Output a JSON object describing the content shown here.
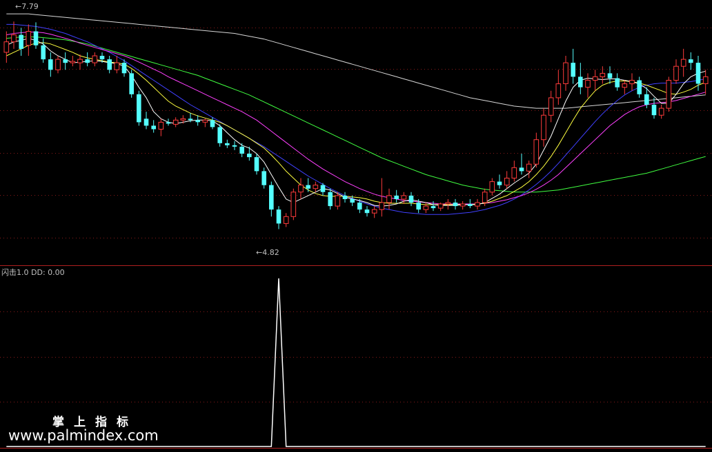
{
  "chart_data": [
    {
      "type": "candlestick",
      "title": "",
      "price_range": [
        4.5,
        8.0
      ],
      "annotations": {
        "high_label": "7.79",
        "low_label": "4.82"
      },
      "colors": {
        "up": "#ff3b3b",
        "down": "#54ffff",
        "ma5": "#ffffff",
        "ma10": "#ffff40",
        "ma20": "#ff40ff",
        "ma30": "#4040ff",
        "ma60": "#40ff40",
        "ma120": "#d8d8d8"
      },
      "ohlc": [
        [
          7.35,
          7.65,
          7.2,
          7.5
        ],
        [
          7.5,
          7.79,
          7.4,
          7.6
        ],
        [
          7.6,
          7.7,
          7.3,
          7.4
        ],
        [
          7.45,
          7.75,
          7.3,
          7.65
        ],
        [
          7.65,
          7.78,
          7.4,
          7.45
        ],
        [
          7.45,
          7.55,
          7.2,
          7.25
        ],
        [
          7.25,
          7.35,
          7.0,
          7.1
        ],
        [
          7.1,
          7.3,
          7.05,
          7.25
        ],
        [
          7.25,
          7.35,
          7.1,
          7.2
        ],
        [
          7.2,
          7.3,
          7.15,
          7.22
        ],
        [
          7.2,
          7.32,
          7.1,
          7.25
        ],
        [
          7.25,
          7.35,
          7.15,
          7.2
        ],
        [
          7.2,
          7.35,
          7.15,
          7.3
        ],
        [
          7.3,
          7.35,
          7.2,
          7.25
        ],
        [
          7.25,
          7.3,
          7.05,
          7.1
        ],
        [
          7.1,
          7.3,
          7.05,
          7.2
        ],
        [
          7.2,
          7.25,
          7.0,
          7.05
        ],
        [
          7.05,
          7.1,
          6.7,
          6.75
        ],
        [
          6.75,
          6.8,
          6.3,
          6.35
        ],
        [
          6.4,
          6.5,
          6.25,
          6.3
        ],
        [
          6.3,
          6.38,
          6.2,
          6.25
        ],
        [
          6.25,
          6.4,
          6.15,
          6.35
        ],
        [
          6.35,
          6.4,
          6.3,
          6.33
        ],
        [
          6.32,
          6.42,
          6.28,
          6.38
        ],
        [
          6.38,
          6.45,
          6.33,
          6.4
        ],
        [
          6.4,
          6.48,
          6.35,
          6.38
        ],
        [
          6.38,
          6.45,
          6.3,
          6.35
        ],
        [
          6.35,
          6.4,
          6.28,
          6.38
        ],
        [
          6.38,
          6.42,
          6.25,
          6.28
        ],
        [
          6.28,
          6.32,
          6.0,
          6.05
        ],
        [
          6.05,
          6.1,
          5.98,
          6.02
        ],
        [
          6.02,
          6.08,
          5.95,
          6.0
        ],
        [
          6.0,
          6.05,
          5.85,
          5.9
        ],
        [
          5.9,
          6.0,
          5.8,
          5.85
        ],
        [
          5.85,
          5.9,
          5.6,
          5.65
        ],
        [
          5.65,
          5.7,
          5.4,
          5.45
        ],
        [
          5.45,
          5.5,
          5.0,
          5.1
        ],
        [
          5.1,
          5.15,
          4.82,
          4.9
        ],
        [
          4.9,
          5.05,
          4.85,
          5.0
        ],
        [
          5.0,
          5.4,
          4.95,
          5.35
        ],
        [
          5.35,
          5.55,
          5.25,
          5.45
        ],
        [
          5.45,
          5.55,
          5.35,
          5.4
        ],
        [
          5.4,
          5.5,
          5.35,
          5.45
        ],
        [
          5.45,
          5.48,
          5.3,
          5.35
        ],
        [
          5.35,
          5.4,
          5.1,
          5.15
        ],
        [
          5.15,
          5.35,
          5.1,
          5.3
        ],
        [
          5.3,
          5.35,
          5.2,
          5.25
        ],
        [
          5.25,
          5.3,
          5.15,
          5.2
        ],
        [
          5.2,
          5.25,
          5.05,
          5.1
        ],
        [
          5.1,
          5.15,
          5.0,
          5.05
        ],
        [
          5.05,
          5.15,
          4.98,
          5.1
        ],
        [
          5.1,
          5.55,
          5.0,
          5.2
        ],
        [
          5.2,
          5.4,
          5.1,
          5.3
        ],
        [
          5.3,
          5.38,
          5.2,
          5.25
        ],
        [
          5.25,
          5.35,
          5.18,
          5.3
        ],
        [
          5.3,
          5.35,
          5.15,
          5.2
        ],
        [
          5.2,
          5.25,
          5.05,
          5.1
        ],
        [
          5.1,
          5.2,
          5.05,
          5.15
        ],
        [
          5.15,
          5.22,
          5.08,
          5.12
        ],
        [
          5.12,
          5.2,
          5.08,
          5.18
        ],
        [
          5.18,
          5.25,
          5.1,
          5.2
        ],
        [
          5.2,
          5.25,
          5.1,
          5.15
        ],
        [
          5.15,
          5.22,
          5.1,
          5.18
        ],
        [
          5.18,
          5.25,
          5.12,
          5.15
        ],
        [
          5.15,
          5.25,
          5.1,
          5.2
        ],
        [
          5.2,
          5.4,
          5.15,
          5.35
        ],
        [
          5.35,
          5.55,
          5.3,
          5.5
        ],
        [
          5.5,
          5.6,
          5.4,
          5.45
        ],
        [
          5.45,
          5.65,
          5.4,
          5.55
        ],
        [
          5.55,
          5.8,
          5.5,
          5.7
        ],
        [
          5.7,
          5.9,
          5.6,
          5.65
        ],
        [
          5.65,
          5.8,
          5.55,
          5.75
        ],
        [
          5.75,
          6.2,
          5.7,
          6.1
        ],
        [
          6.1,
          6.55,
          6.0,
          6.45
        ],
        [
          6.45,
          6.8,
          6.35,
          6.7
        ],
        [
          6.7,
          7.1,
          6.6,
          6.9
        ],
        [
          6.9,
          7.3,
          6.8,
          7.2
        ],
        [
          7.2,
          7.4,
          6.9,
          7.0
        ],
        [
          7.0,
          7.2,
          6.75,
          6.85
        ],
        [
          6.85,
          7.05,
          6.7,
          6.95
        ],
        [
          6.95,
          7.1,
          6.8,
          7.0
        ],
        [
          7.0,
          7.15,
          6.9,
          7.05
        ],
        [
          7.05,
          7.15,
          6.9,
          6.98
        ],
        [
          6.98,
          7.05,
          6.8,
          6.85
        ],
        [
          6.85,
          6.95,
          6.75,
          6.9
        ],
        [
          6.9,
          7.05,
          6.8,
          6.95
        ],
        [
          6.95,
          7.0,
          6.7,
          6.75
        ],
        [
          6.75,
          6.85,
          6.55,
          6.6
        ],
        [
          6.6,
          6.7,
          6.4,
          6.45
        ],
        [
          6.45,
          6.6,
          6.4,
          6.55
        ],
        [
          6.55,
          7.0,
          6.5,
          6.95
        ],
        [
          6.95,
          7.25,
          6.9,
          7.15
        ],
        [
          7.15,
          7.4,
          7.0,
          7.25
        ],
        [
          7.25,
          7.35,
          7.1,
          7.2
        ],
        [
          7.2,
          7.3,
          6.8,
          6.9
        ],
        [
          6.9,
          7.1,
          6.75,
          7.0
        ]
      ],
      "ma5": [
        7.45,
        7.5,
        7.52,
        7.55,
        7.52,
        7.47,
        7.37,
        7.3,
        7.25,
        7.2,
        7.21,
        7.22,
        7.23,
        7.22,
        7.2,
        7.19,
        7.15,
        7.02,
        6.85,
        6.7,
        6.5,
        6.4,
        6.35,
        6.33,
        6.35,
        6.37,
        6.38,
        6.38,
        6.37,
        6.3,
        6.2,
        6.1,
        6.02,
        5.98,
        5.9,
        5.78,
        5.6,
        5.42,
        5.25,
        5.2,
        5.25,
        5.3,
        5.35,
        5.4,
        5.38,
        5.33,
        5.28,
        5.25,
        5.23,
        5.2,
        5.16,
        5.15,
        5.16,
        5.18,
        5.22,
        5.24,
        5.22,
        5.2,
        5.17,
        5.16,
        5.16,
        5.16,
        5.17,
        5.17,
        5.17,
        5.2,
        5.26,
        5.32,
        5.4,
        5.48,
        5.55,
        5.62,
        5.75,
        5.95,
        6.15,
        6.4,
        6.65,
        6.85,
        6.95,
        6.98,
        6.97,
        6.96,
        6.97,
        6.97,
        6.95,
        6.93,
        6.9,
        6.83,
        6.72,
        6.62,
        6.62,
        6.75,
        6.9,
        7.0,
        7.05,
        7.08
      ],
      "ma10": [
        7.3,
        7.35,
        7.4,
        7.45,
        7.48,
        7.49,
        7.47,
        7.43,
        7.39,
        7.35,
        7.3,
        7.27,
        7.25,
        7.23,
        7.21,
        7.2,
        7.18,
        7.12,
        7.04,
        6.95,
        6.85,
        6.75,
        6.65,
        6.58,
        6.53,
        6.48,
        6.44,
        6.41,
        6.38,
        6.35,
        6.3,
        6.24,
        6.18,
        6.12,
        6.05,
        5.98,
        5.88,
        5.77,
        5.65,
        5.55,
        5.45,
        5.38,
        5.33,
        5.3,
        5.29,
        5.29,
        5.29,
        5.28,
        5.27,
        5.25,
        5.22,
        5.2,
        5.19,
        5.19,
        5.19,
        5.19,
        5.18,
        5.17,
        5.17,
        5.17,
        5.17,
        5.17,
        5.17,
        5.17,
        5.18,
        5.19,
        5.22,
        5.26,
        5.3,
        5.36,
        5.42,
        5.5,
        5.6,
        5.72,
        5.86,
        6.02,
        6.2,
        6.38,
        6.55,
        6.68,
        6.8,
        6.88,
        6.92,
        6.94,
        6.94,
        6.93,
        6.91,
        6.88,
        6.84,
        6.8,
        6.76,
        6.75,
        6.78,
        6.82,
        6.88,
        6.92
      ],
      "ma20": [
        7.6,
        7.62,
        7.63,
        7.64,
        7.64,
        7.63,
        7.61,
        7.58,
        7.55,
        7.52,
        7.48,
        7.45,
        7.42,
        7.39,
        7.36,
        7.33,
        7.3,
        7.26,
        7.21,
        7.16,
        7.11,
        7.06,
        7.0,
        6.95,
        6.9,
        6.85,
        6.8,
        6.75,
        6.7,
        6.65,
        6.6,
        6.55,
        6.5,
        6.44,
        6.38,
        6.3,
        6.22,
        6.14,
        6.06,
        5.98,
        5.9,
        5.82,
        5.75,
        5.68,
        5.62,
        5.56,
        5.5,
        5.45,
        5.4,
        5.36,
        5.32,
        5.29,
        5.27,
        5.25,
        5.23,
        5.22,
        5.21,
        5.2,
        5.19,
        5.18,
        5.18,
        5.18,
        5.18,
        5.18,
        5.18,
        5.19,
        5.2,
        5.22,
        5.24,
        5.27,
        5.3,
        5.34,
        5.39,
        5.45,
        5.52,
        5.6,
        5.7,
        5.8,
        5.9,
        6.0,
        6.1,
        6.2,
        6.3,
        6.38,
        6.46,
        6.52,
        6.57,
        6.6,
        6.62,
        6.63,
        6.64,
        6.66,
        6.69,
        6.72,
        6.75,
        6.78
      ],
      "ma30": [
        7.75,
        7.75,
        7.74,
        7.73,
        7.72,
        7.7,
        7.68,
        7.65,
        7.62,
        7.58,
        7.54,
        7.5,
        7.45,
        7.4,
        7.35,
        7.29,
        7.23,
        7.16,
        7.09,
        7.02,
        6.95,
        6.88,
        6.81,
        6.74,
        6.67,
        6.6,
        6.54,
        6.48,
        6.42,
        6.36,
        6.3,
        6.24,
        6.18,
        6.12,
        6.06,
        6.0,
        5.93,
        5.86,
        5.79,
        5.72,
        5.65,
        5.58,
        5.52,
        5.46,
        5.4,
        5.35,
        5.3,
        5.26,
        5.22,
        5.18,
        5.15,
        5.12,
        5.1,
        5.08,
        5.06,
        5.05,
        5.04,
        5.03,
        5.03,
        5.03,
        5.03,
        5.04,
        5.05,
        5.06,
        5.08,
        5.1,
        5.13,
        5.16,
        5.2,
        5.25,
        5.31,
        5.38,
        5.46,
        5.55,
        5.65,
        5.76,
        5.88,
        6.0,
        6.12,
        6.24,
        6.36,
        6.47,
        6.57,
        6.66,
        6.74,
        6.8,
        6.85,
        6.88,
        6.9,
        6.91,
        6.91,
        6.91,
        6.92,
        6.93,
        6.95,
        6.97
      ],
      "ma60": [
        7.55,
        7.56,
        7.57,
        7.57,
        7.57,
        7.56,
        7.55,
        7.54,
        7.53,
        7.51,
        7.49,
        7.47,
        7.44,
        7.41,
        7.38,
        7.35,
        7.32,
        7.29,
        7.26,
        7.23,
        7.2,
        7.17,
        7.14,
        7.11,
        7.08,
        7.05,
        7.02,
        6.98,
        6.94,
        6.9,
        6.86,
        6.82,
        6.78,
        6.74,
        6.69,
        6.64,
        6.59,
        6.54,
        6.49,
        6.44,
        6.39,
        6.34,
        6.29,
        6.24,
        6.19,
        6.14,
        6.09,
        6.04,
        5.99,
        5.94,
        5.89,
        5.84,
        5.8,
        5.76,
        5.72,
        5.68,
        5.64,
        5.6,
        5.57,
        5.54,
        5.51,
        5.48,
        5.45,
        5.43,
        5.41,
        5.39,
        5.38,
        5.37,
        5.36,
        5.35,
        5.35,
        5.35,
        5.35,
        5.36,
        5.37,
        5.38,
        5.4,
        5.42,
        5.44,
        5.46,
        5.48,
        5.5,
        5.52,
        5.54,
        5.56,
        5.58,
        5.6,
        5.62,
        5.65,
        5.68,
        5.71,
        5.74,
        5.77,
        5.8,
        5.83,
        5.86
      ],
      "ma120": [
        7.9,
        7.9,
        7.9,
        7.9,
        7.89,
        7.88,
        7.87,
        7.86,
        7.85,
        7.84,
        7.83,
        7.82,
        7.81,
        7.8,
        7.79,
        7.78,
        7.77,
        7.76,
        7.75,
        7.74,
        7.73,
        7.72,
        7.71,
        7.7,
        7.69,
        7.68,
        7.67,
        7.66,
        7.65,
        7.64,
        7.63,
        7.62,
        7.6,
        7.58,
        7.56,
        7.54,
        7.51,
        7.48,
        7.45,
        7.42,
        7.39,
        7.36,
        7.33,
        7.3,
        7.27,
        7.24,
        7.21,
        7.18,
        7.15,
        7.12,
        7.09,
        7.06,
        7.03,
        7.0,
        6.97,
        6.94,
        6.91,
        6.88,
        6.85,
        6.82,
        6.79,
        6.76,
        6.73,
        6.7,
        6.68,
        6.66,
        6.64,
        6.62,
        6.6,
        6.58,
        6.57,
        6.56,
        6.55,
        6.55,
        6.55,
        6.55,
        6.55,
        6.56,
        6.57,
        6.58,
        6.59,
        6.6,
        6.61,
        6.62,
        6.63,
        6.64,
        6.65,
        6.66,
        6.67,
        6.68,
        6.69,
        6.7,
        6.71,
        6.72,
        6.73,
        6.74
      ]
    },
    {
      "type": "line",
      "title": "闪击1.0",
      "legend": "DD: 0.00",
      "series": [
        {
          "name": "DD",
          "color": "#ffffff",
          "values": [
            0,
            0,
            0,
            0,
            0,
            0,
            0,
            0,
            0,
            0,
            0,
            0,
            0,
            0,
            0,
            0,
            0,
            0,
            0,
            0,
            0,
            0,
            0,
            0,
            0,
            0,
            0,
            0,
            0,
            0,
            0,
            0,
            0,
            0,
            0,
            0,
            0,
            1,
            0,
            0,
            0,
            0,
            0,
            0,
            0,
            0,
            0,
            0,
            0,
            0,
            0,
            0,
            0,
            0,
            0,
            0,
            0,
            0,
            0,
            0,
            0,
            0,
            0,
            0,
            0,
            0,
            0,
            0,
            0,
            0,
            0,
            0,
            0,
            0,
            0,
            0,
            0,
            0,
            0,
            0,
            0,
            0,
            0,
            0,
            0,
            0,
            0,
            0,
            0,
            0,
            0,
            0,
            0,
            0,
            0,
            0
          ]
        }
      ],
      "ylim": [
        0,
        1
      ]
    }
  ],
  "watermark": {
    "chinese": "掌上指标",
    "url": "www.palmindex.com"
  }
}
